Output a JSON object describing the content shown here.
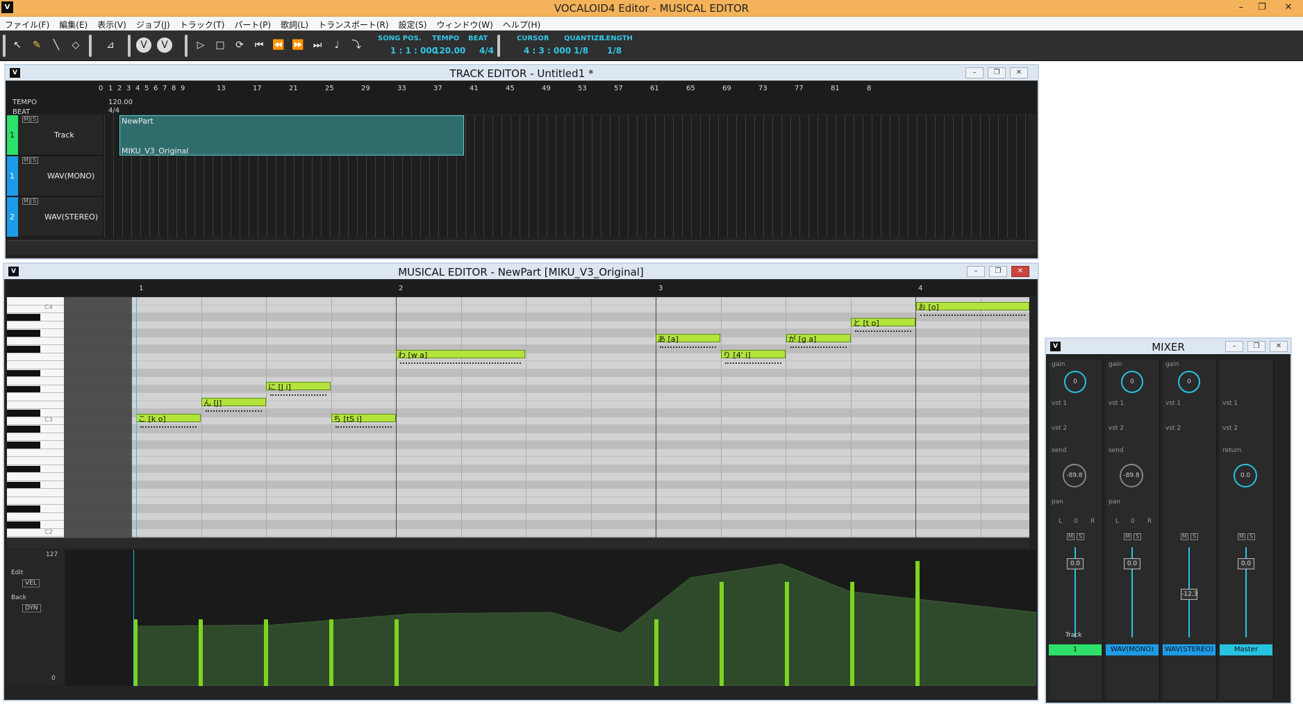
{
  "app": {
    "title": "VOCALOID4 Editor - MUSICAL EDITOR",
    "icon_letter": "V",
    "window_controls": [
      "–",
      "❐",
      "✕"
    ]
  },
  "menu": [
    "ファイル(F)",
    "編集(E)",
    "表示(V)",
    "ジョブ(J)",
    "トラック(T)",
    "パート(P)",
    "歌詞(L)",
    "トランスポート(R)",
    "設定(S)",
    "ウィンドウ(W)",
    "ヘルプ(H)"
  ],
  "toolbar": {
    "song_pos_label": "SONG POS.",
    "song_pos": "1 : 1 : 000",
    "tempo_label": "TEMPO",
    "tempo": "120.00",
    "beat_label": "BEAT",
    "beat": "4/4",
    "cursor_label": "CURSOR",
    "cursor": "4 : 3 : 000",
    "quantize_label": "QUANTIZE",
    "quantize": "1/8",
    "length_label": "LENGTH",
    "length": "1/8"
  },
  "track_editor": {
    "title": "TRACK EDITOR - Untitled1 *",
    "tempo_label": "TEMPO",
    "beat_label": "BEAT",
    "tempo_value": "120.00",
    "beat_value": "4/4",
    "ruler": [
      "0",
      "1",
      "2",
      "3",
      "4",
      "5",
      "6",
      "7",
      "8",
      "9",
      "13",
      "17",
      "21",
      "25",
      "29",
      "33",
      "37",
      "41",
      "45",
      "49",
      "53",
      "57",
      "61",
      "65",
      "69",
      "73",
      "77",
      "81",
      "8"
    ],
    "tracks": [
      {
        "num": "1",
        "name": "Track",
        "color": "#2de06a"
      },
      {
        "num": "1",
        "name": "WAV(MONO)",
        "color": "#1e9be8"
      },
      {
        "num": "2",
        "name": "WAV(STEREO)",
        "color": "#1e9be8"
      }
    ],
    "part": {
      "name": "NewPart",
      "singer": "MIKU_V3_Original"
    }
  },
  "musical_editor": {
    "title": "MUSICAL EDITOR - NewPart [MIKU_V3_Original]",
    "measures": [
      "1",
      "2",
      "3",
      "4"
    ],
    "key_labels": [
      "C4",
      "C3",
      "C2"
    ],
    "notes": [
      {
        "lyric": "こ [k o]"
      },
      {
        "lyric": "ん [J]"
      },
      {
        "lyric": "に [J i]"
      },
      {
        "lyric": "ち [tS i]"
      },
      {
        "lyric": "わ [w a]"
      },
      {
        "lyric": "あ [a]"
      },
      {
        "lyric": "り [4' i]"
      },
      {
        "lyric": "が [g a]"
      },
      {
        "lyric": "と [t o]"
      },
      {
        "lyric": "お [o]"
      }
    ],
    "control": {
      "max": "127",
      "min": "0",
      "edit_label": "Edit",
      "edit_value": "VEL",
      "back_label": "Back",
      "back_value": "DYN",
      "velocities": [
        64,
        64,
        64,
        64,
        64,
        64,
        100,
        100,
        100,
        120
      ]
    }
  },
  "mixer": {
    "title": "MIXER",
    "gain_label": "gain",
    "vst1_label": "vst 1",
    "vst2_label": "vst 2",
    "send_label": "send",
    "return_label": "return",
    "pan_label": "pan",
    "pan_l": "L",
    "pan_r": "R",
    "channels": [
      {
        "gain": "0",
        "send": "-89.8",
        "pan": "0",
        "fader": "0.0",
        "name": "Track",
        "chan": "1",
        "color": "#2de06a"
      },
      {
        "gain": "0",
        "send": "-89.8",
        "pan": "0",
        "fader": "0.0",
        "name": "",
        "chan": "WAV(MONO)",
        "color": "#1e9be8"
      },
      {
        "gain": "0",
        "send": "",
        "pan": "",
        "fader": "-12.3",
        "name": "",
        "chan": "WAV(STEREO)",
        "color": "#1e9be8"
      },
      {
        "gain": "",
        "send": "0.0",
        "pan": "",
        "fader": "0.0",
        "name": "",
        "chan": "Master",
        "color": "#27c3e0"
      }
    ]
  }
}
